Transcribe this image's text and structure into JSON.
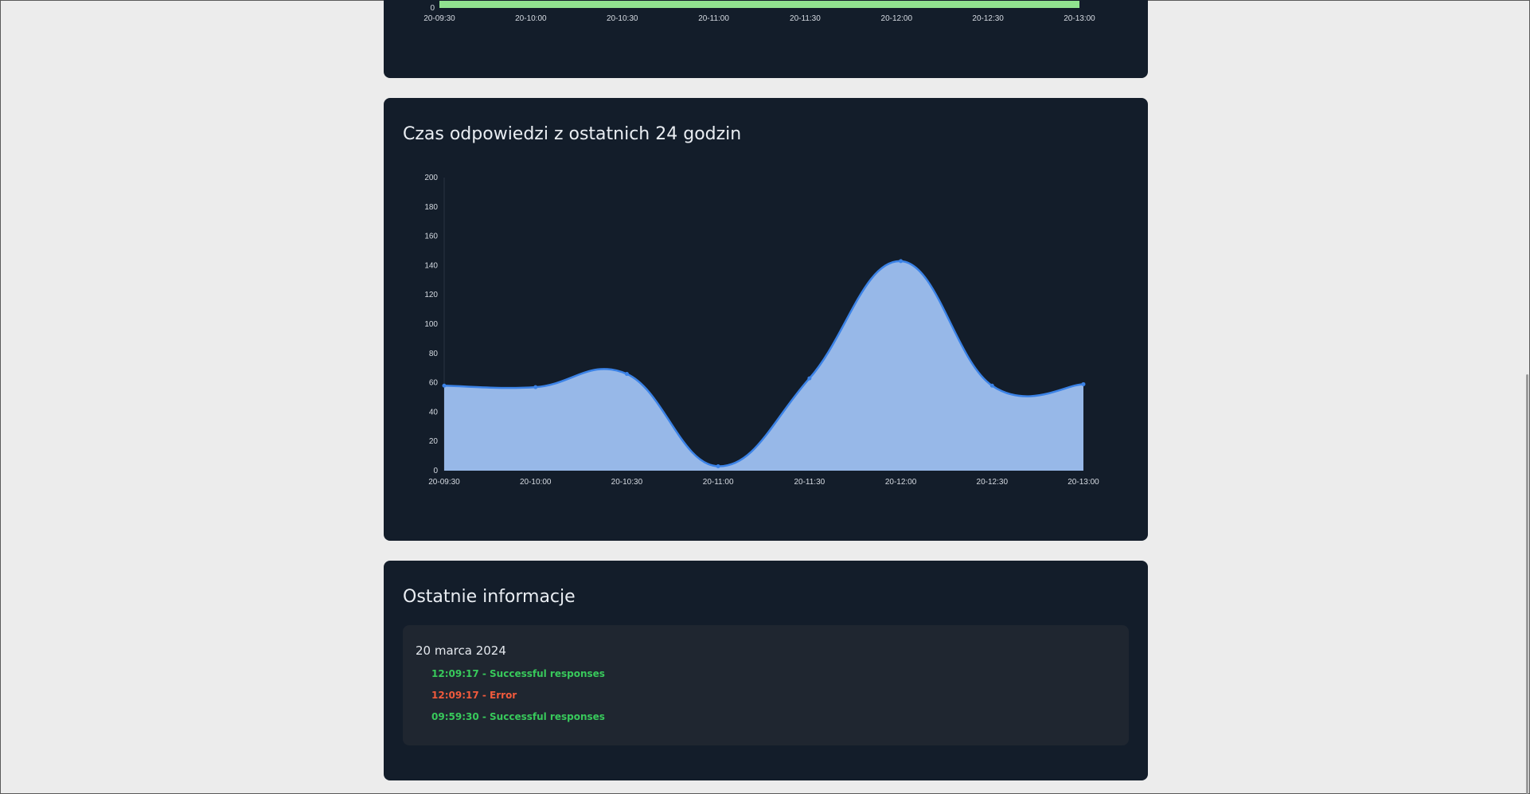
{
  "colors": {
    "page_bg": "#ececec",
    "card_bg": "#131d2a",
    "info_box_bg": "#1f2630",
    "status_bar_green": "#90e28f",
    "line_blue": "#3b82e6",
    "area_fill": "#97b8e8",
    "success": "#38c95b",
    "error": "#f05a3c"
  },
  "status_card": {
    "chart_data": {
      "type": "bar",
      "x": [
        "20-09:30",
        "20-10:00",
        "20-10:30",
        "20-11:00",
        "20-11:30",
        "20-12:00",
        "20-12:30",
        "20-13:00"
      ],
      "y_ticks": [
        "0"
      ],
      "bar_from": "20-09:30",
      "bar_to": "20-13:00",
      "bar_color": "#90e28f"
    }
  },
  "response_card": {
    "title": "Czas odpowiedzi z ostatnich 24 godzin",
    "chart_data": {
      "type": "area",
      "x": [
        "20-09:30",
        "20-10:00",
        "20-10:30",
        "20-11:00",
        "20-11:30",
        "20-12:00",
        "20-12:30",
        "20-13:00"
      ],
      "values": [
        58,
        57,
        66,
        3,
        63,
        143,
        58,
        59
      ],
      "ylim": [
        0,
        200
      ],
      "y_ticks": [
        0,
        20,
        40,
        60,
        80,
        100,
        120,
        140,
        160,
        180,
        200
      ],
      "line_color": "#3b82e6",
      "fill_color": "#97b8e8"
    }
  },
  "info_card": {
    "title": "Ostatnie informacje",
    "date": "20 marca 2024",
    "items": [
      {
        "text": "12:09:17 - Successful responses",
        "status": "success"
      },
      {
        "text": "12:09:17 - Error",
        "status": "error"
      },
      {
        "text": "09:59:30 - Successful responses",
        "status": "success"
      }
    ]
  }
}
